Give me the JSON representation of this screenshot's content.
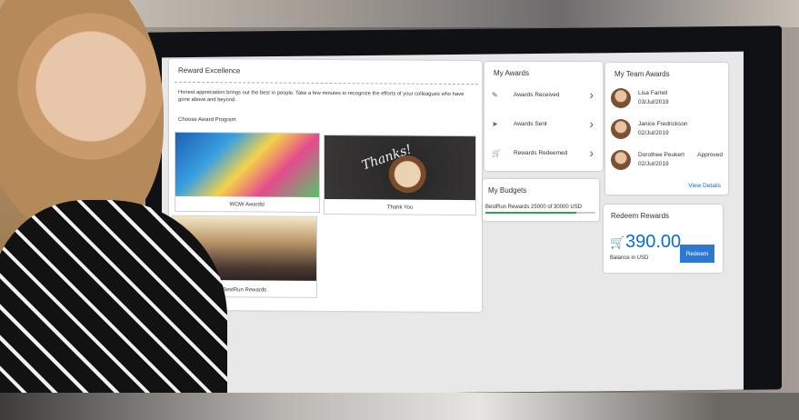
{
  "reward": {
    "title": "Reward Excellence",
    "description": "Honest appreciation brings out the best in people. Take a few minutes to recognize the efforts of your colleagues who have gone above and beyond.",
    "choose_label": "Choose Award Program",
    "programs": [
      {
        "label": "WOW Awards!"
      },
      {
        "label": "Thank You",
        "image_text": "Thanks!"
      },
      {
        "label": "BestRun Rewards"
      }
    ]
  },
  "my_awards": {
    "title": "My Awards",
    "items": [
      {
        "label": "Awards Received",
        "icon": "award-icon"
      },
      {
        "label": "Awards Sent",
        "icon": "send-icon"
      },
      {
        "label": "Rewards Redeemed",
        "icon": "cart-icon"
      }
    ]
  },
  "budgets": {
    "title": "My Budgets",
    "line": "BestRun Rewards    25000 of 30000 USD",
    "progress": 0.83,
    "bar_color": "#2fa44f"
  },
  "team": {
    "title": "My Team Awards",
    "people": [
      {
        "name": "Lisa Farrell",
        "date": "03/Jul/2019",
        "status": ""
      },
      {
        "name": "Janice Fredrickson",
        "date": "02/Jul/2019",
        "status": ""
      },
      {
        "name": "Dorothee Peukert",
        "date": "02/Jul/2019",
        "status": "Approved"
      }
    ],
    "view_details": "View Details"
  },
  "redeem": {
    "title": "Redeem Rewards",
    "amount": "390.00",
    "balance_label": "Balance in USD",
    "button": "Redeem"
  },
  "colors": {
    "accent": "#0a6ed1"
  }
}
